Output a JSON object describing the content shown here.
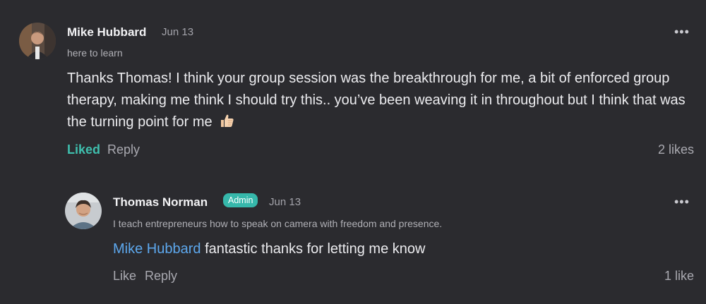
{
  "comments": [
    {
      "author": "Mike Hubbard",
      "date": "Jun 13",
      "bio": "here to learn",
      "text": "Thanks Thomas! I think your group session was the breakthrough for me, a bit of enforced group therapy, making me think I should try this.. you’ve been weaving it in throughout but I think that was the turning point for me",
      "emoji": "thumbs-up-icon",
      "like_label": "Liked",
      "reply_label": "Reply",
      "likes": "2 likes",
      "more_label": "•••"
    }
  ],
  "reply": {
    "author": "Thomas Norman",
    "badge": "Admin",
    "date": "Jun 13",
    "bio": "I teach entrepreneurs how to speak on camera with freedom and presence.",
    "mention": "Mike Hubbard",
    "text": " fantastic thanks for letting me know",
    "like_label": "Like",
    "reply_label": "Reply",
    "likes": "1 like",
    "more_label": "•••"
  },
  "colors": {
    "background": "#2b2b2f",
    "liked": "#3fbfae",
    "badge": "#36b8ab",
    "mention": "#5da8ee"
  }
}
